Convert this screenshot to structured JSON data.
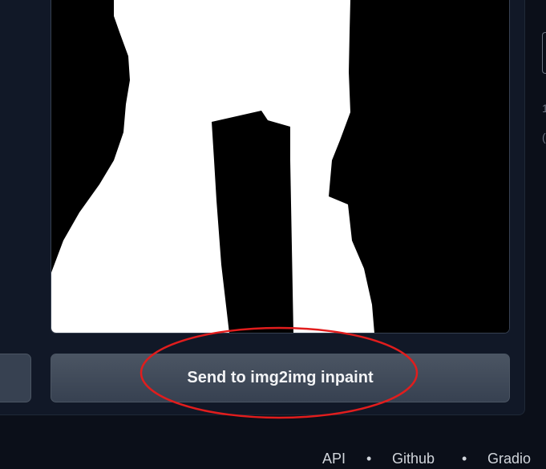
{
  "image_panel": {
    "content": "mask-image"
  },
  "actions": {
    "send_to_inpaint_label": "Send to img2img inpaint"
  },
  "annotation": {
    "shape": "ellipse",
    "color": "#e11d1d"
  },
  "right_edge": {
    "chars": [
      "1",
      "("
    ]
  },
  "footer": {
    "links": [
      "API",
      "Github",
      "Gradio"
    ],
    "separator": "•"
  }
}
